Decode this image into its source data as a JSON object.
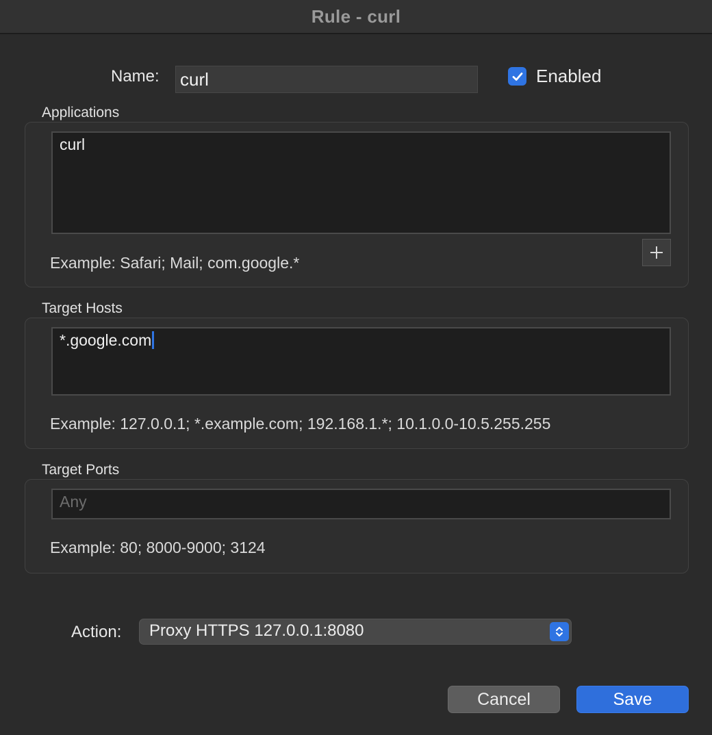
{
  "window": {
    "title": "Rule - curl"
  },
  "name": {
    "label": "Name:",
    "value": "curl"
  },
  "enabled": {
    "label": "Enabled",
    "checked": true
  },
  "applications": {
    "label": "Applications",
    "value": "curl",
    "example": "Example: Safari; Mail; com.google.*",
    "add_icon": "plus-icon"
  },
  "target_hosts": {
    "label": "Target Hosts",
    "value": "*.google.com",
    "example": "Example: 127.0.0.1; *.example.com; 192.168.1.*; 10.1.0.0-10.5.255.255"
  },
  "target_ports": {
    "label": "Target Ports",
    "value": "",
    "placeholder": "Any",
    "example": "Example: 80; 8000-9000; 3124"
  },
  "action": {
    "label": "Action:",
    "selected": "Proxy HTTPS 127.0.0.1:8080",
    "icon": "up-down-chevron-icon"
  },
  "buttons": {
    "cancel": "Cancel",
    "save": "Save"
  },
  "colors": {
    "accent": "#2f74e3",
    "background": "#2b2b2b",
    "field_background": "#1e1e1e"
  }
}
